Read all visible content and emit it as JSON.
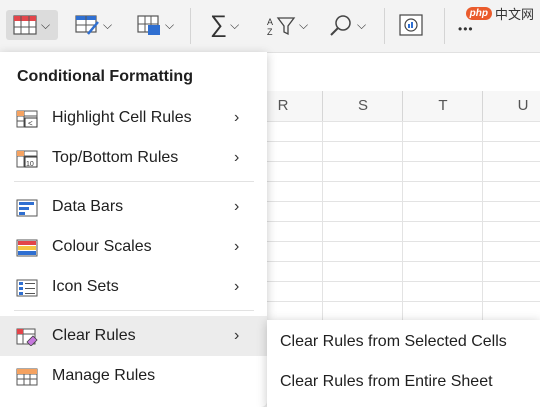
{
  "watermark": {
    "badge": "php",
    "text": "中文网"
  },
  "columns": [
    "R",
    "S",
    "T",
    "U"
  ],
  "menu": {
    "title": "Conditional Formatting",
    "items": [
      {
        "label": "Highlight Cell Rules",
        "icon": "highlight-cell-rules-icon"
      },
      {
        "label": "Top/Bottom Rules",
        "icon": "top-bottom-rules-icon"
      },
      {
        "label": "Data Bars",
        "icon": "data-bars-icon"
      },
      {
        "label": "Colour Scales",
        "icon": "colour-scales-icon"
      },
      {
        "label": "Icon Sets",
        "icon": "icon-sets-icon"
      },
      {
        "label": "Clear Rules",
        "icon": "clear-rules-icon"
      },
      {
        "label": "Manage Rules",
        "icon": "manage-rules-icon"
      }
    ],
    "chevron": "›"
  },
  "submenu": {
    "items": [
      {
        "label": "Clear Rules from Selected Cells"
      },
      {
        "label": "Clear Rules from Entire Sheet"
      }
    ]
  },
  "toolbar": {
    "sum_glyph": "∑",
    "more_glyph": "•••"
  }
}
